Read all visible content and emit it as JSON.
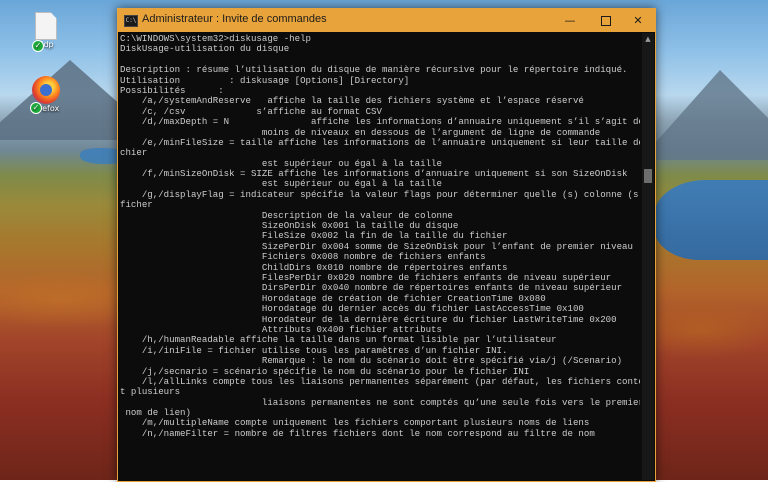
{
  "desktop": {
    "icons": [
      {
        "label": "Sdp",
        "icon": "file-icon"
      },
      {
        "label": "Firefox",
        "icon": "firefox-icon"
      }
    ]
  },
  "window": {
    "title": "Administrateur : Invite de commandes",
    "accent_color": "#e8a33a",
    "controls": {
      "minimize": "—",
      "maximize": "",
      "close": "✕"
    }
  },
  "console": {
    "lines": [
      "C:\\WINDOWS\\system32>diskusage -help",
      "DiskUsage-utilisation du disque",
      "",
      "Description : résume l’utilisation du disque de manière récursive pour le répertoire indiqué.",
      "Utilisation         : diskusage [Options] [Directory]",
      "Possibilités      :",
      "    /a,/systemAndReserve   affiche la taille des fichiers système et l’espace réservé",
      "    /c, /csv             s’affiche au format CSV",
      "    /d,/maxDepth = N               affiche les informations d’annuaire uniquement s’il s’agit de N ou",
      "                          moins de niveaux en dessous de l’argument de ligne de commande",
      "    /e,/minFileSize = taille affiche les informations de l’annuaire uniquement si leur taille de fi",
      "chier",
      "                          est supérieur ou égal à la taille",
      "    /f,/minSizeOnDisk = SIZE affiche les informations d’annuaire uniquement si son SizeOnDisk",
      "                          est supérieur ou égal à la taille",
      "    /g,/displayFlag = indicateur spécifie la valeur flags pour déterminer quelle (s) colonne (s) af",
      "ficher",
      "                          Description de la valeur de colonne",
      "                          SizeOnDisk 0x001 la taille du disque",
      "                          FileSize 0x002 la fin de la taille du fichier",
      "                          SizePerDir 0x004 somme de SizeOnDisk pour l’enfant de premier niveau",
      "                          Fichiers 0x008 nombre de fichiers enfants",
      "                          ChildDirs 0x010 nombre de répertoires enfants",
      "                          FilesPerDir 0x020 nombre de fichiers enfants de niveau supérieur",
      "                          DirsPerDir 0x040 nombre de répertoires enfants de niveau supérieur",
      "                          Horodatage de création de fichier CreationTime 0x080",
      "                          Horodatage du dernier accès du fichier LastAccessTime 0x100",
      "                          Horodateur de la dernière écriture du fichier LastWriteTime 0x200",
      "                          Attributs 0x400 fichier attributs",
      "    /h,/humanReadable affiche la taille dans un format lisible par l’utilisateur",
      "    /i,/iniFile = fichier utilise tous les paramètres d’un fichier INI.",
      "                          Remarque : le nom du scénario doit être spécifié via/j (/Scenario)",
      "    /j,/secnario = scénario spécifie le nom du scénario pour le fichier INI",
      "    /l,/allLinks compte tous les liaisons permanentes séparément (par défaut, les fichiers contenan",
      "t plusieurs",
      "                          liaisons permanentes ne sont comptés qu’une seule fois vers le premier",
      " nom de lien)",
      "    /m,/multipleName compte uniquement les fichiers comportant plusieurs noms de liens",
      "    /n,/nameFilter = nombre de filtres fichiers dont le nom correspond au filtre de nom"
    ]
  }
}
